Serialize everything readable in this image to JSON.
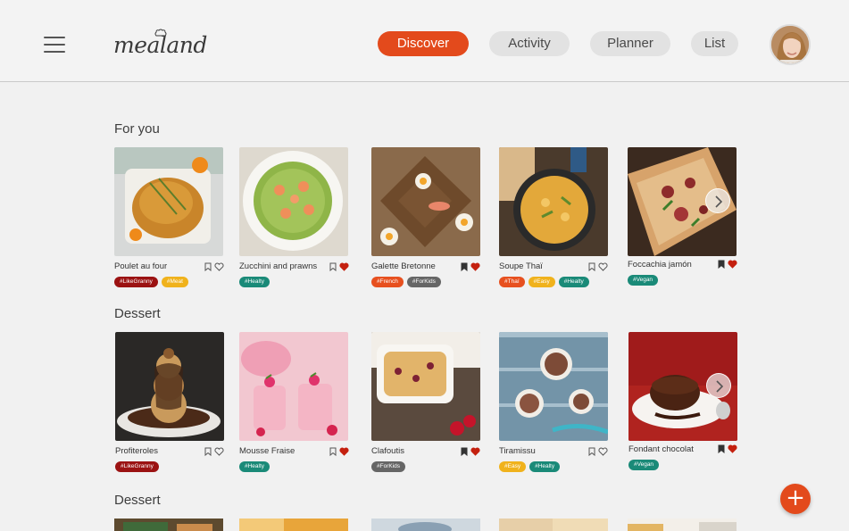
{
  "brand": {
    "name": "mealand"
  },
  "nav": [
    {
      "label": "Discover",
      "active": true
    },
    {
      "label": "Activity",
      "active": false
    },
    {
      "label": "Planner",
      "active": false
    },
    {
      "label": "List",
      "active": false
    }
  ],
  "colors": {
    "accent": "#e34a1c",
    "dark_red": "#9b1212",
    "teal": "#1a8a78",
    "grey": "#666666",
    "orange": "#e7501f",
    "yellow": "#f0b21c"
  },
  "sections": [
    {
      "title": "For you",
      "cards": [
        {
          "name": "Poulet au four",
          "saved": false,
          "liked": false,
          "tags": [
            {
              "label": "#LikeGranny",
              "color": "#9b1212"
            },
            {
              "label": "#Meat",
              "color": "#f0b21c"
            }
          ]
        },
        {
          "name": "Zucchini and prawns",
          "saved": false,
          "liked": true,
          "tags": [
            {
              "label": "#Healty",
              "color": "#1a8a78"
            }
          ]
        },
        {
          "name": "Galette Bretonne",
          "saved": true,
          "liked": true,
          "tags": [
            {
              "label": "#French",
              "color": "#e7501f"
            },
            {
              "label": "#ForKids",
              "color": "#666666"
            }
          ]
        },
        {
          "name": "Soupe Thaï",
          "saved": false,
          "liked": false,
          "tags": [
            {
              "label": "#Thaï",
              "color": "#e7501f"
            },
            {
              "label": "#Easy",
              "color": "#f0b21c"
            },
            {
              "label": "#Healty",
              "color": "#1a8a78"
            }
          ]
        },
        {
          "name": "Foccachia jamón",
          "saved": true,
          "liked": true,
          "tags": [
            {
              "label": "#Vegan",
              "color": "#1a8a78"
            }
          ]
        }
      ]
    },
    {
      "title": "Dessert",
      "cards": [
        {
          "name": "Profiteroles",
          "saved": false,
          "liked": false,
          "tags": [
            {
              "label": "#LikeGranny",
              "color": "#9b1212"
            }
          ]
        },
        {
          "name": "Mousse Fraise",
          "saved": false,
          "liked": true,
          "tags": [
            {
              "label": "#Healty",
              "color": "#1a8a78"
            }
          ]
        },
        {
          "name": "Clafoutis",
          "saved": true,
          "liked": true,
          "tags": [
            {
              "label": "#ForKids",
              "color": "#666666"
            }
          ]
        },
        {
          "name": "Tiramissu",
          "saved": false,
          "liked": false,
          "tags": [
            {
              "label": "#Easy",
              "color": "#f0b21c"
            },
            {
              "label": "#Healty",
              "color": "#1a8a78"
            }
          ]
        },
        {
          "name": "Fondant chocolat",
          "saved": true,
          "liked": true,
          "tags": [
            {
              "label": "#Vegan",
              "color": "#1a8a78"
            }
          ]
        }
      ]
    },
    {
      "title": "Dessert",
      "cards": []
    }
  ],
  "fab": {
    "label": "+"
  }
}
